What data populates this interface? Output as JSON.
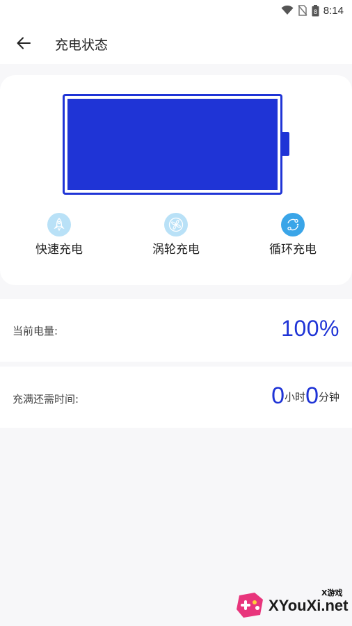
{
  "status_bar": {
    "time": "8:14",
    "battery_level": "8",
    "icons": [
      "wifi-icon",
      "no-sim-icon",
      "battery-icon"
    ]
  },
  "app_bar": {
    "back_icon": "arrow-left-icon",
    "title": "充电状态"
  },
  "battery": {
    "fill_fraction": 1.0,
    "color": "#1f34d6"
  },
  "modes": [
    {
      "label": "快速充电",
      "icon": "rocket-icon",
      "active": false
    },
    {
      "label": "涡轮充电",
      "icon": "turbo-fan-icon",
      "active": false
    },
    {
      "label": "循环充电",
      "icon": "cycle-icon",
      "active": true
    }
  ],
  "current_level": {
    "label": "当前电量:",
    "value": "100%"
  },
  "time_to_full": {
    "label": "充满还需时间:",
    "hours": "0",
    "hours_unit": "小时",
    "minutes": "0",
    "minutes_unit": "分钟"
  },
  "watermark": {
    "small_text": "X游戏",
    "text": "XYouXi.net"
  },
  "colors": {
    "accent": "#1f34d6",
    "mode_icon_light": "#b9e1f7",
    "mode_icon_active": "#3aa5e8",
    "background": "#f7f7f9"
  }
}
